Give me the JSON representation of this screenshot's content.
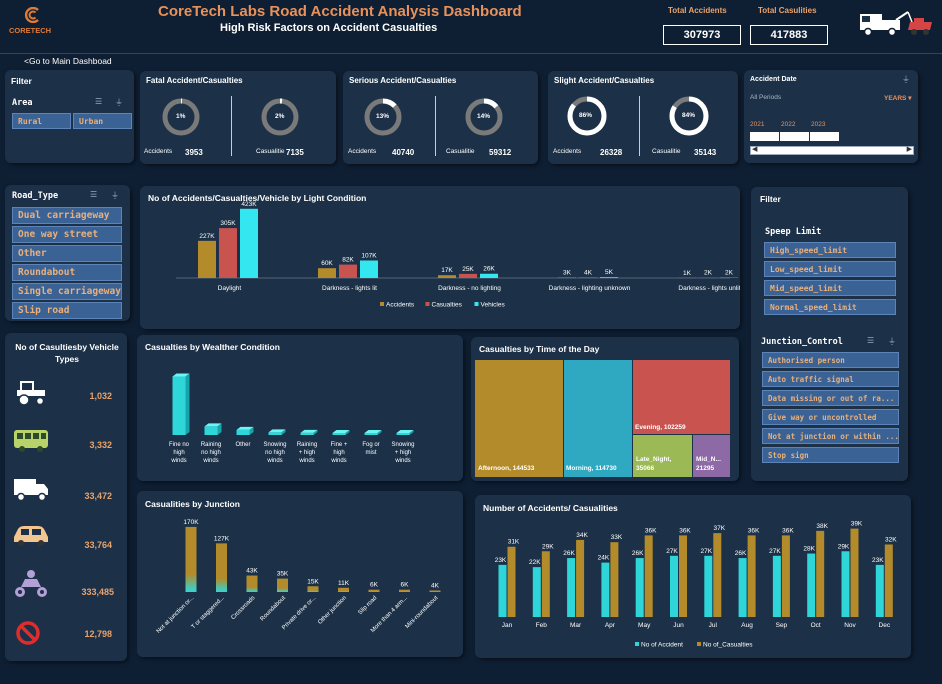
{
  "header": {
    "logo_text": "CORETECH",
    "title": "CoreTech Labs Road Accident Analysis Dashboard",
    "subtitle": "High Risk Factors on Accident Casualties",
    "total_accidents_label": "Total Accidents",
    "total_accidents": "307973",
    "total_casualties_label": "Total Casulities",
    "total_casualties": "417883",
    "back_link": "<Go to Main Dashboad"
  },
  "filter_area": {
    "title": "Filter",
    "slicer_label": "Area",
    "options": [
      "Rural",
      "Urban"
    ]
  },
  "severity": [
    {
      "title": "Fatal Accident/Casualties",
      "acc_pct": "1%",
      "acc_label": "Accidents",
      "acc_value": "3953",
      "cas_pct": "2%",
      "cas_label": "Casualitie",
      "cas_value": "7135",
      "acc_frac": 0.01,
      "cas_frac": 0.02
    },
    {
      "title": "Serious Accident/Casualties",
      "acc_pct": "13%",
      "acc_label": "Accidents",
      "acc_value": "40740",
      "cas_pct": "14%",
      "cas_label": "Casualitie",
      "cas_value": "59312",
      "acc_frac": 0.13,
      "cas_frac": 0.14
    },
    {
      "title": "Slight Accident/Casualties",
      "acc_pct": "86%",
      "acc_label": "Accidents",
      "acc_value": "26328",
      "cas_pct": "84%",
      "cas_label": "Casualitie",
      "cas_value": "35143",
      "acc_frac": 0.86,
      "cas_frac": 0.84
    }
  ],
  "date_filter": {
    "title": "Accident Date",
    "period": "All Periods",
    "unit": "YEARS",
    "years": [
      "2021",
      "2022",
      "2023"
    ]
  },
  "road_type": {
    "title": "Road_Type",
    "options": [
      "Dual carriageway",
      "One way street",
      "Other",
      "Roundabout",
      "Single carriageway",
      "Slip road"
    ]
  },
  "vehicle_types": {
    "title": "No of Casultiesby Vehicle Types",
    "items": [
      {
        "icon": "tractor-icon",
        "value": "1,032"
      },
      {
        "icon": "bus-icon",
        "value": "3,332"
      },
      {
        "icon": "truck-icon",
        "value": "33,472"
      },
      {
        "icon": "car-icon",
        "value": "33,764"
      },
      {
        "icon": "motorcycle-icon",
        "value": "333,485"
      },
      {
        "icon": "prohibited-icon",
        "value": "12,798"
      }
    ]
  },
  "filter_right": {
    "title": "Filter",
    "speed_label": "Speep Limit",
    "speed_options": [
      "High_speed_limit",
      "Low_speed_limit",
      "Mid_speed_limit",
      "Normal_speed_limit"
    ],
    "junction_label": "Junction_Control",
    "junction_options": [
      "Authorised person",
      "Auto traffic signal",
      "Data missing or out of ra...",
      "Give way or uncontrolled",
      "Not at junction or within ...",
      "Stop sign"
    ]
  },
  "colors": {
    "accidents": "#b38b2a",
    "casualties": "#c9544f",
    "vehicles": "#33e6f0",
    "cyan": "#2ed6d9",
    "gold": "#b38b2a"
  },
  "chart_data": [
    {
      "type": "bar",
      "title": "No of Accidents/Casualties/Vehicle by Light Condition",
      "categories": [
        "Daylight",
        "Darkness - lights lit",
        "Darkness - no lighting",
        "Darkness - lighting unknown",
        "Darkness - lights unlit"
      ],
      "series": [
        {
          "name": "Accidents",
          "values": [
            227,
            60,
            17,
            3,
            1
          ],
          "labels": [
            "227K",
            "60K",
            "17K",
            "3K",
            "1K"
          ]
        },
        {
          "name": "Casualties",
          "values": [
            305,
            82,
            25,
            4,
            2
          ],
          "labels": [
            "305K",
            "82K",
            "25K",
            "4K",
            "2K"
          ]
        },
        {
          "name": "Vehicles",
          "values": [
            423,
            107,
            26,
            5,
            2
          ],
          "labels": [
            "423K",
            "107K",
            "26K",
            "5K",
            "2K"
          ]
        }
      ],
      "ylim": [
        0,
        440
      ]
    },
    {
      "type": "bar",
      "title": "Casualties by Wealther Condition",
      "categories": [
        "Fine no high winds",
        "Raining no high winds",
        "Other",
        "Snowing no high winds",
        "Raining + high winds",
        "Fine + high winds",
        "Fog or mist",
        "Snowing + high winds"
      ],
      "values": [
        340,
        50,
        30,
        15,
        12,
        10,
        6,
        3
      ],
      "ylim": [
        0,
        360
      ]
    },
    {
      "type": "heatmap",
      "title": "Casualties by Time of the Day",
      "cells": [
        {
          "name": "Afternoon",
          "value": 144533
        },
        {
          "name": "Morning",
          "value": 114730
        },
        {
          "name": "Evening",
          "value": 102259
        },
        {
          "name": "Late_Night",
          "value": 35066
        },
        {
          "name": "Mid_N...",
          "value": 21295
        }
      ]
    },
    {
      "type": "bar",
      "title": "Casualities by Junction",
      "categories": [
        "Not at junction or...",
        "T or staggered...",
        "Crossroads",
        "Roundabout",
        "Private drive or...",
        "Other junction",
        "Slip road",
        "More than 4 arm...",
        "Mini-roundabout"
      ],
      "values": [
        170,
        127,
        43,
        35,
        15,
        11,
        6,
        6,
        4
      ],
      "labels": [
        "170K",
        "127K",
        "43K",
        "35K",
        "15K",
        "11K",
        "6K",
        "6K",
        "4K"
      ],
      "ylim": [
        0,
        175
      ]
    },
    {
      "type": "bar",
      "title": "Number of Accidents/ Casualities",
      "categories": [
        "Jan",
        "Feb",
        "Mar",
        "Apr",
        "May",
        "Jun",
        "Jul",
        "Aug",
        "Sep",
        "Oct",
        "Nov",
        "Dec"
      ],
      "series": [
        {
          "name": "No of Accident",
          "values": [
            23,
            22,
            26,
            24,
            26,
            27,
            27,
            26,
            27,
            28,
            29,
            23
          ],
          "labels": [
            "23K",
            "22K",
            "26K",
            "24K",
            "26K",
            "27K",
            "27K",
            "26K",
            "27K",
            "28K",
            "29K",
            "23K"
          ]
        },
        {
          "name": "No of_Casualties",
          "values": [
            31,
            29,
            34,
            33,
            36,
            36,
            37,
            36,
            36,
            38,
            39,
            32
          ],
          "labels": [
            "31K",
            "29K",
            "34K",
            "33K",
            "36K",
            "36K",
            "37K",
            "36K",
            "36K",
            "38K",
            "39K",
            "32K"
          ]
        }
      ],
      "ylim": [
        0,
        45
      ]
    }
  ]
}
